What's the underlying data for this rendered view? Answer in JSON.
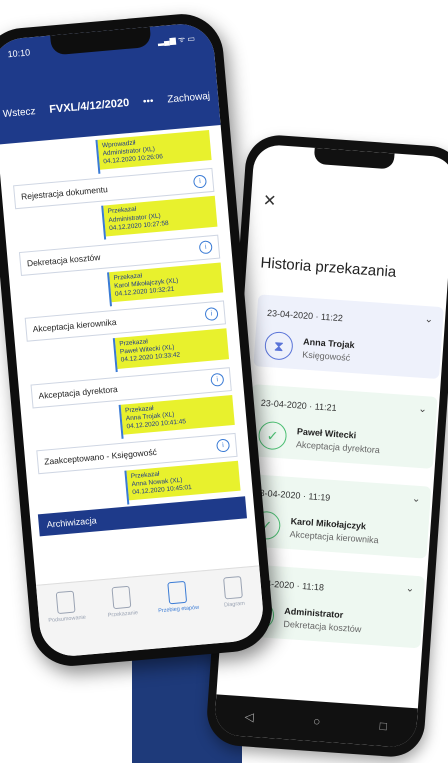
{
  "android": {
    "back_icon": "close-icon",
    "title": "Historia przekazania",
    "entries": [
      {
        "time": "23-04-2020 · 11:22",
        "name": "Anna Trojak",
        "role": "Księgowość",
        "icon": "hourglass-icon",
        "state": "pending"
      },
      {
        "time": "23-04-2020 · 11:21",
        "name": "Paweł Witecki",
        "role": "Akceptacja dyrektora",
        "icon": "check-icon",
        "state": "done"
      },
      {
        "time": "23-04-2020 · 11:19",
        "name": "Karol Mikołajczyk",
        "role": "Akceptacja kierownika",
        "icon": "check-icon",
        "state": "done"
      },
      {
        "time": "23-04-2020 · 11:18",
        "name": "Administrator",
        "role": "Dekretacja kosztów",
        "icon": "check-icon",
        "state": "done"
      }
    ],
    "nav": {
      "back": "◁",
      "home": "○",
      "recent": "□"
    }
  },
  "iphone": {
    "time": "10:10",
    "status": "▂▄▆ ᯤ ▭",
    "nav_back": "Wstecz",
    "document_number": "FVXL/4/12/2020",
    "more": "•••",
    "save": "Zachowaj",
    "history": [
      [
        "Wprowadził",
        "Administrator (XL)",
        "04.12.2020 10:26:06"
      ],
      [
        "Przekazał",
        "Administrator (XL)",
        "04.12.2020 10:27:58"
      ],
      [
        "Przekazał",
        "Karol Mikołajczyk (XL)",
        "04.12.2020 10:32:21"
      ],
      [
        "Przekazał",
        "Paweł Witecki (XL)",
        "04.12.2020 10:33:42"
      ],
      [
        "Przekazał",
        "Anna Trojak (XL)",
        "04.12.2020 10:41:45"
      ],
      [
        "Przekazał",
        "Anna Nowak (XL)",
        "04.12.2020 10:45:01"
      ]
    ],
    "stages": [
      "Rejestracja dokumentu",
      "Dekretacja kosztów",
      "Akceptacja kierownika",
      "Akceptacja dyrektora",
      "Zaakceptowano - Księgowość"
    ],
    "archive": "Archiwizacja",
    "tabs": [
      {
        "label": "Podsumowanie",
        "icon": "document-icon",
        "active": false
      },
      {
        "label": "Przekazanie",
        "icon": "document-icon",
        "active": false
      },
      {
        "label": "Przebieg etapów",
        "icon": "workflow-icon",
        "active": true
      },
      {
        "label": "Diagram",
        "icon": "diagram-icon",
        "active": false
      }
    ]
  },
  "colors": {
    "navy": "#1e3a8a",
    "yellow": "#e8f12d",
    "green": "#4cbf73",
    "blue": "#5a74d8"
  }
}
